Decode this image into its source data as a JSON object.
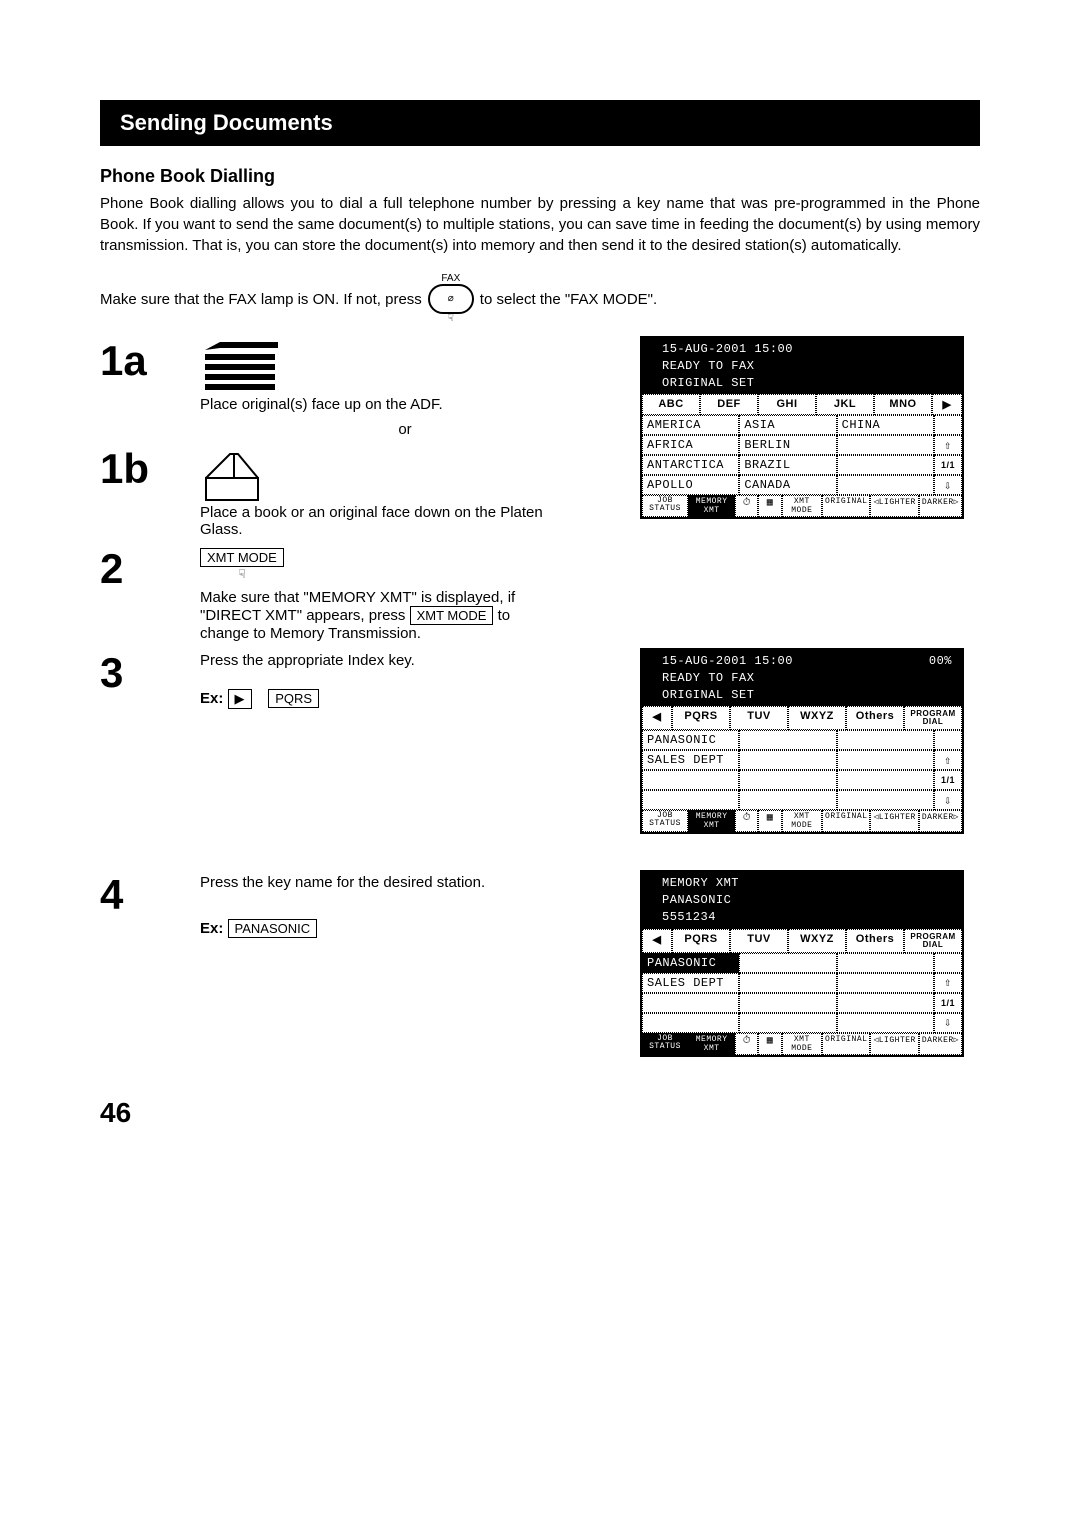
{
  "header": "Sending Documents",
  "subheading": "Phone Book Dialling",
  "intro": "Phone Book dialling allows you to dial a full telephone number by pressing a key name that was pre-programmed in the Phone Book.  If you want to send the same document(s) to multiple stations, you can save time in feeding the document(s) by using memory transmission.  That is, you can store the document(s) into memory and then send it to the desired station(s) automatically.",
  "faxLine": {
    "pre": "Make sure that the FAX lamp is ON.  If not, press",
    "iconLabel": "FAX",
    "iconInner": "⌀",
    "post": " to select the \"FAX MODE\"."
  },
  "steps": {
    "s1a": {
      "num": "1a",
      "text": "Place original(s) face up on the ADF."
    },
    "or": "or",
    "s1b": {
      "num": "1b",
      "text": "Place a book or an original face down on the Platen Glass."
    },
    "s2": {
      "num": "2",
      "btn": "XMT MODE",
      "text1": "Make sure that \"MEMORY XMT\" is displayed, if \"DIRECT XMT\" appears, press ",
      "btn2": "XMT MODE",
      "text2": " to change to Memory Transmission."
    },
    "s3": {
      "num": "3",
      "text": "Press the appropriate Index key.",
      "ex": "Ex:",
      "arrow": "▶",
      "pqrs": "PQRS"
    },
    "s4": {
      "num": "4",
      "text": "Press the key name for the desired station.",
      "ex": "Ex:",
      "name": "PANASONIC"
    }
  },
  "lcd1": {
    "top": [
      "15-AUG-2001 15:00",
      "READY TO FAX",
      "ORIGINAL SET"
    ],
    "tabs": [
      "ABC",
      "DEF",
      "GHI",
      "JKL",
      "MNO",
      "▶"
    ],
    "rows": [
      [
        "AMERICA",
        "ASIA",
        "CHINA"
      ],
      [
        "AFRICA",
        "BERLIN",
        ""
      ],
      [
        "ANTARCTICA",
        "BRAZIL",
        ""
      ],
      [
        "APOLLO",
        "CANADA",
        ""
      ]
    ],
    "side": [
      "",
      "⇧",
      "1/1",
      "⇩"
    ],
    "footer": {
      "job": "JOB\nSTATUS",
      "memxmt": "MEMORY XMT",
      "timer1": "⏱",
      "timer2": "▦",
      "xmt": "XMT MODE",
      "orig": "ORIGINAL",
      "light": "◁LIGHTER",
      "dark": "DARKER▷",
      "selJob": false,
      "selMem": true
    }
  },
  "lcd2": {
    "top": [
      "15-AUG-2001 15:00",
      "READY TO FAX",
      "ORIGINAL SET"
    ],
    "pct": "00%",
    "tabs": [
      "◀",
      "PQRS",
      "TUV",
      "WXYZ",
      "Others",
      "PROGRAM\nDIAL"
    ],
    "rows": [
      [
        "PANASONIC",
        "",
        ""
      ],
      [
        "SALES DEPT",
        "",
        ""
      ],
      [
        "",
        "",
        ""
      ],
      [
        "",
        "",
        ""
      ]
    ],
    "side": [
      "",
      "⇧",
      "1/1",
      "⇩"
    ],
    "footer": {
      "job": "JOB\nSTATUS",
      "memxmt": "MEMORY XMT",
      "timer1": "⏱",
      "timer2": "▦",
      "xmt": "XMT MODE",
      "orig": "ORIGINAL",
      "light": "◁LIGHTER",
      "dark": "DARKER▷",
      "selJob": false,
      "selMem": true
    }
  },
  "lcd3": {
    "top": [
      "MEMORY XMT",
      "PANASONIC",
      "5551234"
    ],
    "tabs": [
      "◀",
      "PQRS",
      "TUV",
      "WXYZ",
      "Others",
      "PROGRAM\nDIAL"
    ],
    "rows": [
      [
        "PANASONIC",
        "",
        ""
      ],
      [
        "SALES DEPT",
        "",
        ""
      ],
      [
        "",
        "",
        ""
      ],
      [
        "",
        "",
        ""
      ]
    ],
    "rowSel": [
      [
        true,
        false,
        false
      ],
      [
        false,
        false,
        false
      ],
      [
        false,
        false,
        false
      ],
      [
        false,
        false,
        false
      ]
    ],
    "side": [
      "",
      "⇧",
      "1/1",
      "⇩"
    ],
    "footer": {
      "job": "JOB\nSTATUS",
      "memxmt": "MEMORY XMT",
      "timer1": "⏱",
      "timer2": "▦",
      "xmt": "XMT MODE",
      "orig": "ORIGINAL",
      "light": "◁LIGHTER",
      "dark": "DARKER▷",
      "selJob": true,
      "selMem": true
    }
  },
  "pageNumber": "46"
}
